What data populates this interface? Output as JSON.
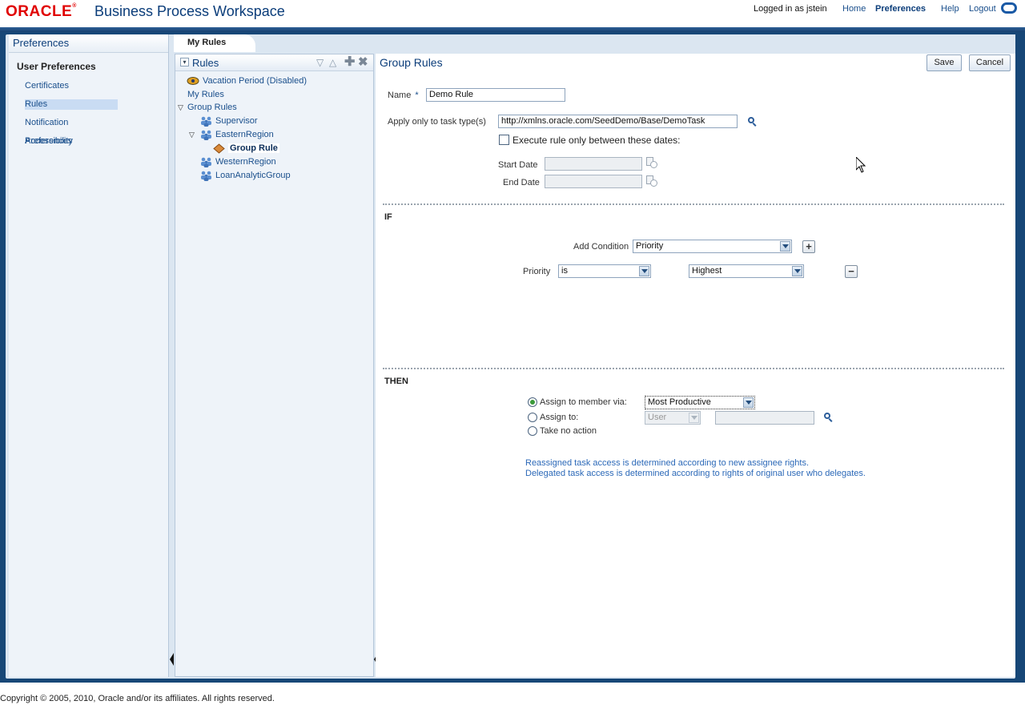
{
  "header": {
    "logo": "ORACLE",
    "app_title": "Business Process Workspace",
    "logged_in_label": "Logged in as",
    "user": "jstein",
    "links": {
      "home": "Home",
      "preferences": "Preferences",
      "help": "Help",
      "logout": "Logout"
    }
  },
  "left_panel": {
    "title": "Preferences",
    "section_title": "User Preferences",
    "items": [
      {
        "label": "Certificates",
        "selected": false
      },
      {
        "label": "Rules",
        "selected": true
      },
      {
        "label": "Notification Preferences",
        "selected": false
      },
      {
        "label": "Accessibility",
        "selected": false
      }
    ]
  },
  "tabs": [
    {
      "label": "My Rules",
      "active": true
    }
  ],
  "tree": {
    "title": "Rules",
    "items": [
      {
        "label": "Vacation Period (Disabled)",
        "icon": "vacation-icon"
      },
      {
        "label": "My Rules"
      },
      {
        "label": "Group Rules",
        "expanded": true
      },
      {
        "label": "Supervisor",
        "icon": "group-icon"
      },
      {
        "label": "EasternRegion",
        "icon": "group-icon",
        "expanded": true
      },
      {
        "label": "Group Rule",
        "icon": "rule-icon",
        "selected": true
      },
      {
        "label": "WesternRegion",
        "icon": "group-icon"
      },
      {
        "label": "LoanAnalyticGroup",
        "icon": "group-icon"
      }
    ]
  },
  "detail": {
    "title": "Group Rules",
    "save": "Save",
    "cancel": "Cancel",
    "name_label": "Name",
    "required_mark": "*",
    "name_value": "Demo Rule",
    "task_type_label": "Apply only to task type(s)",
    "task_type_value": "http://xmlns.oracle.com/SeedDemo/Base/DemoTask",
    "execute_between_label": "Execute rule only between these dates:",
    "execute_between_checked": false,
    "start_date_label": "Start Date",
    "start_date_value": "",
    "end_date_label": "End Date",
    "end_date_value": "",
    "if_label": "IF",
    "add_condition_label": "Add Condition",
    "add_condition_value": "Priority",
    "condition": {
      "label": "Priority",
      "operator": "is",
      "value": "Highest"
    },
    "then_label": "THEN",
    "actions": [
      {
        "label": "Assign to member via:",
        "checked": true,
        "select": "Most Productive"
      },
      {
        "label": "Assign to:",
        "checked": false,
        "select": "User",
        "value": ""
      },
      {
        "label": "Take no action",
        "checked": false
      }
    ],
    "notes": [
      "Reassigned task access is determined according to new assignee rights.",
      "Delegated task access is determined according to rights of original user who delegates."
    ]
  },
  "footer": {
    "copyright": "Copyright © 2005, 2010, Oracle and/or its affiliates. All rights reserved."
  },
  "colors": {
    "brand_red": "#e00000",
    "frame_blue": "#174777",
    "link_blue": "#1a4f8c",
    "note_blue": "#2c69b8"
  }
}
